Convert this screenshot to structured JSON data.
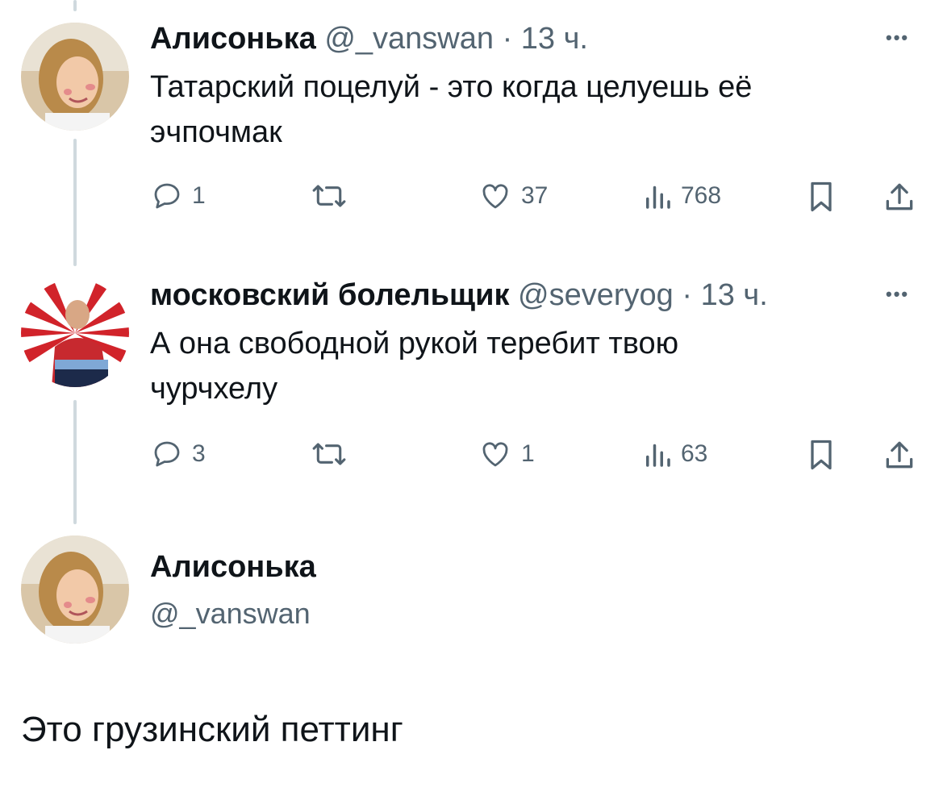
{
  "tweets": [
    {
      "author": "Алисонька",
      "handle": "@_vanswan",
      "time": "13 ч.",
      "text_lines": [
        "Татарский поцелуй - это когда целуешь её",
        "эчпочмак"
      ],
      "replies": "1",
      "likes": "37",
      "views": "768"
    },
    {
      "author": "московский болельщик",
      "handle": "@severyog",
      "time": "13 ч.",
      "text_lines": [
        "А она свободной рукой теребит твою",
        "чурчхелу"
      ],
      "replies": "3",
      "likes": "1",
      "views": "63"
    }
  ],
  "main_tweet": {
    "author": "Алисонька",
    "handle": "@_vanswan",
    "text": "Это грузинский петтинг"
  },
  "separator": "·",
  "more_icon": "•••",
  "icons": [
    "reply-icon",
    "retweet-icon",
    "like-icon",
    "views-icon",
    "bookmark-icon",
    "share-icon"
  ],
  "colors": {
    "text": "#0f1419",
    "secondary": "#536471",
    "thread_line": "#cfd9de"
  }
}
